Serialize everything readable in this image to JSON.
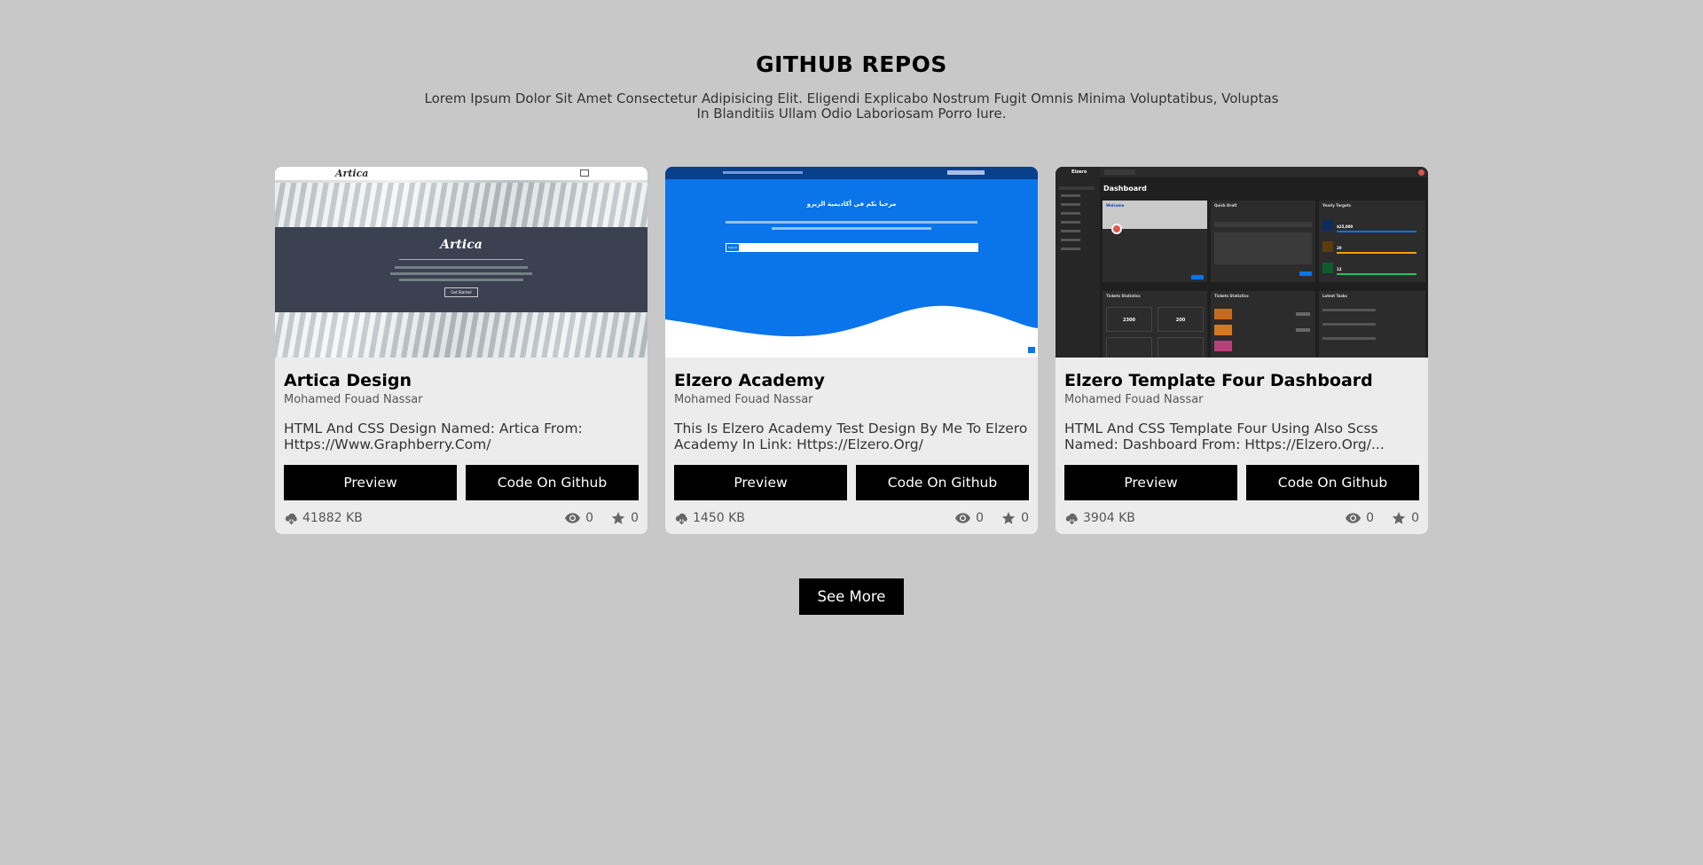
{
  "header": {
    "title": "GITHUB REPOS",
    "description": "Lorem Ipsum Dolor Sit Amet Consectetur Adipisicing Elit. Eligendi Explicabo Nostrum Fugit Omnis Minima Voluptatibus, Voluptas In Blanditiis Ullam Odio Laboriosam Porro Iure."
  },
  "repos": [
    {
      "title": "Artica Design",
      "author": "Mohamed Fouad Nassar",
      "description": "HTML And CSS Design Named: Artica From: Https://Www.Graphberry.Com/",
      "preview_label": "Preview",
      "github_label": "Code On Github",
      "size": "41882 KB",
      "watchers": "0",
      "stars": "0",
      "thumb": {
        "brand": "Artica",
        "hero_title": "Artica",
        "hero_button": "Get Started"
      }
    },
    {
      "title": "Elzero Academy",
      "author": "Mohamed Fouad Nassar",
      "description": "This Is Elzero Academy Test Design By Me To Elzero Academy In Link: Https://Elzero.Org/",
      "preview_label": "Preview",
      "github_label": "Code On Github",
      "size": "1450 KB",
      "watchers": "0",
      "stars": "0",
      "thumb": {
        "hero_title": "مرحبا بكم في أكاديمية الزيرو",
        "search_button": "Search"
      }
    },
    {
      "title": "Elzero Template Four Dashboard",
      "author": "Mohamed Fouad Nassar",
      "description": "HTML And CSS Template Four Using Also Scss Named: Dashboard From: Https://Elzero.Org/...",
      "preview_label": "Preview",
      "github_label": "Code On Github",
      "size": "3904 KB",
      "watchers": "0",
      "stars": "0",
      "thumb": {
        "brand": "Elzero",
        "page_title": "Dashboard",
        "widgets": [
          "Welcome",
          "Quick Draft",
          "Yearly Targets",
          "Tickets Statistics",
          "Tickets Statistics",
          "Latest Tasks"
        ],
        "stats": [
          "2300",
          "200"
        ],
        "targets": [
          "$25,000",
          "20",
          "12"
        ]
      }
    }
  ],
  "see_more_label": "See More",
  "colors": {
    "background": "#c8c8c8",
    "card": "#ececec",
    "button": "#000000"
  },
  "icons": {
    "size": "cloud-download-icon",
    "watchers": "eye-icon",
    "stars": "star-icon"
  }
}
